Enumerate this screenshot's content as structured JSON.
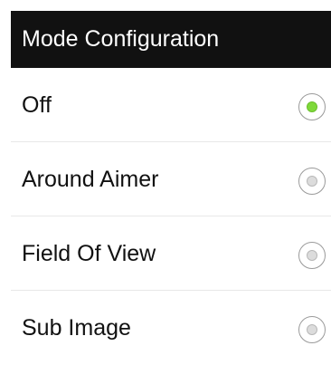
{
  "dialog": {
    "title": "Mode Configuration"
  },
  "options": [
    {
      "label": "Off",
      "selected": true
    },
    {
      "label": "Around Aimer",
      "selected": false
    },
    {
      "label": "Field Of View",
      "selected": false
    },
    {
      "label": "Sub Image",
      "selected": false
    }
  ],
  "colors": {
    "title_bar": "#111111",
    "selected_dot": "#7fd93a",
    "unselected_dot": "#dcdcdc"
  }
}
